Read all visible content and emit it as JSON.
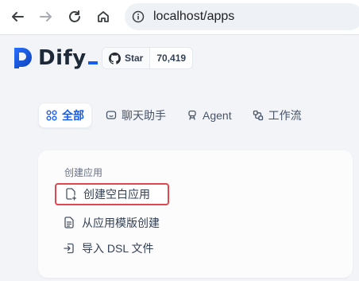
{
  "browser": {
    "url": "localhost/apps"
  },
  "header": {
    "logo_text": "Dify",
    "github": {
      "star_label": "Star",
      "star_count": "70,419"
    }
  },
  "tabs": [
    {
      "label": "全部",
      "icon": "grid-icon",
      "active": true
    },
    {
      "label": "聊天助手",
      "icon": "chat-bubble-icon",
      "active": false
    },
    {
      "label": "Agent",
      "icon": "agent-icon",
      "active": false
    },
    {
      "label": "工作流",
      "icon": "workflow-icon",
      "active": false
    }
  ],
  "create_card": {
    "title": "创建应用",
    "items": [
      {
        "label": "创建空白应用",
        "icon": "file-plus-icon",
        "highlighted": true
      },
      {
        "label": "从应用模版创建",
        "icon": "template-icon",
        "highlighted": false
      },
      {
        "label": "导入 DSL 文件",
        "icon": "import-icon",
        "highlighted": false
      }
    ]
  },
  "colors": {
    "accent": "#155eef",
    "highlight_border": "#e0474f",
    "background": "#f2f4f7"
  }
}
